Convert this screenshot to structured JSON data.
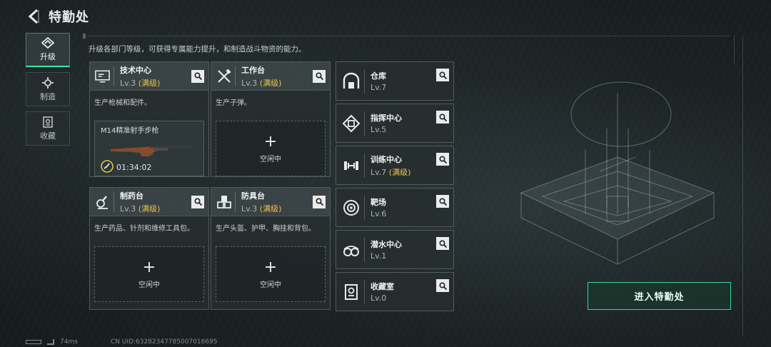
{
  "header": {
    "title": "特勤处"
  },
  "tabs": [
    {
      "label": "升级",
      "icon": "upgrade-icon",
      "active": true
    },
    {
      "label": "制造",
      "icon": "gear-icon",
      "active": false
    },
    {
      "label": "收藏",
      "icon": "collection-icon",
      "active": false
    }
  ],
  "description": "升级各部门等级，可获得专属能力提升，和制造战斗物资的能力。",
  "departments": [
    {
      "name": "技术中心",
      "level": "Lv.3",
      "maxed": "(满级)",
      "desc": "生产枪械和配件。",
      "icon": "monitor-icon",
      "crafting": {
        "item": "M14精准射手步枪",
        "time": "01:34:02"
      }
    },
    {
      "name": "工作台",
      "level": "Lv.3",
      "maxed": "(满级)",
      "desc": "生产子弹。",
      "icon": "tools-icon",
      "slot": {
        "plus": "+",
        "status": "空闲中"
      }
    },
    {
      "name": "制药台",
      "level": "Lv.3",
      "maxed": "(满级)",
      "desc": "生产药品、针剂和维修工具包。",
      "icon": "microscope-icon",
      "slot": {
        "plus": "+",
        "status": "空闲中"
      }
    },
    {
      "name": "防具台",
      "level": "Lv.3",
      "maxed": "(满级)",
      "desc": "生产头盔、护甲、胸挂和背包。",
      "icon": "boxes-icon",
      "slot": {
        "plus": "+",
        "status": "空闲中"
      }
    }
  ],
  "buildings": [
    {
      "name": "仓库",
      "level": "Lv.7",
      "maxed": "",
      "icon": "warehouse-icon"
    },
    {
      "name": "指挥中心",
      "level": "Lv.5",
      "maxed": "",
      "icon": "chip-icon"
    },
    {
      "name": "训练中心",
      "level": "Lv.7",
      "maxed": "(满级)",
      "icon": "dumbbell-icon"
    },
    {
      "name": "靶场",
      "level": "Lv.6",
      "maxed": "",
      "icon": "target-icon"
    },
    {
      "name": "潜水中心",
      "level": "Lv.1",
      "maxed": "",
      "icon": "goggles-icon"
    },
    {
      "name": "收藏室",
      "level": "Lv.0",
      "maxed": "",
      "icon": "trophy-icon"
    }
  ],
  "enter_button": "进入特勤处",
  "footer": {
    "ping": "74ms",
    "uid": "CN UID:632823477850070166​95"
  },
  "colors": {
    "accent": "#34d596",
    "maxed": "#e8c24a"
  }
}
